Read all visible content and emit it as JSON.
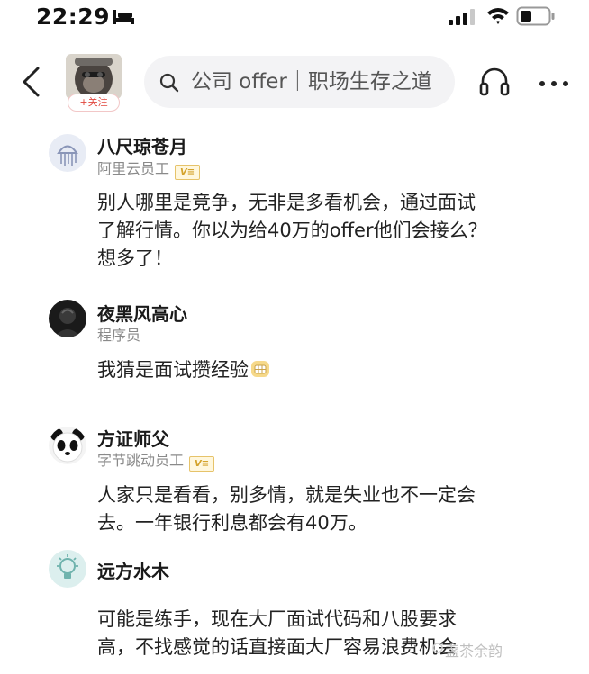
{
  "status_bar": {
    "time": "22:29"
  },
  "header": {
    "follow_label": "+关注",
    "search_placeholder": "公司 offer｜职场生存之道"
  },
  "comments": [
    {
      "name": "八尺琼苍月",
      "role": "阿里云员工",
      "verified": true,
      "lines": [
        "别人哪里是竞争，无非是多看机会，通过面试",
        "了解行情。你以为给40万的offer他们会接么？",
        "想多了！"
      ]
    },
    {
      "name": "夜黑风高心",
      "role": "程序员",
      "verified": false,
      "lines": [
        "我猜是面试攒经验"
      ],
      "emoji": "tooth-grin-emoji"
    },
    {
      "name": "方证师父",
      "role": "字节跳动员工",
      "verified": true,
      "lines": [
        "人家只是看看，别多情，就是失业也不一定会",
        "去。一年银行利息都会有40万。"
      ]
    },
    {
      "name": "远方水木",
      "role": "",
      "verified": false,
      "lines": [
        "可能是练手，现在大厂面试代码和八股要求",
        "高，不找感觉的话直接面大厂容易浪费机会"
      ]
    }
  ],
  "watermark": "盏茶余韵",
  "colors": {
    "follow_red": "#e0463d",
    "badge_gold": "#d4a32c",
    "search_bg": "#f3f3f5"
  }
}
